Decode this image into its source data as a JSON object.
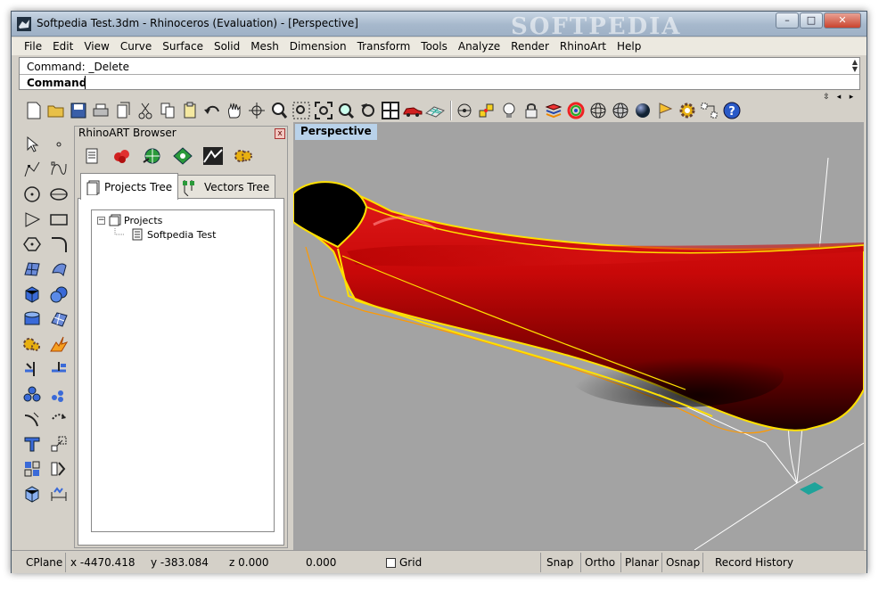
{
  "window": {
    "title": "Softpedia Test.3dm - Rhinoceros (Evaluation) - [Perspective]",
    "watermark": "SOFTPEDIA",
    "controls": {
      "minimize": "–",
      "maximize": "□",
      "close": "✕"
    }
  },
  "menu": [
    "File",
    "Edit",
    "View",
    "Curve",
    "Surface",
    "Solid",
    "Mesh",
    "Dimension",
    "Transform",
    "Tools",
    "Analyze",
    "Render",
    "RhinoArt",
    "Help"
  ],
  "command": {
    "history": "Command: _Delete",
    "prompt": "Command:",
    "value": ""
  },
  "toolbar": [
    "new-file-icon",
    "open-folder-icon",
    "save-icon",
    "print-icon",
    "import-icon",
    "cut-icon",
    "copy-icon",
    "paste-icon",
    "undo-icon",
    "pan-hand-icon",
    "rotate-view-icon",
    "zoom-icon",
    "zoom-window-icon",
    "zoom-extents-icon",
    "zoom-selected-icon",
    "undo-view-icon",
    "four-viewports-icon",
    "car-icon",
    "grid-plane-icon",
    "cplane-icon",
    "osnap-icon",
    "light-bulb-icon",
    "lock-icon",
    "layers-icon",
    "color-wheel-icon",
    "wireframe-sphere-icon",
    "shaded-sphere-icon",
    "rendered-sphere-icon",
    "flag-icon",
    "gear-icon",
    "options-icon",
    "help-icon"
  ],
  "left_toolbar": [
    "select-arrow-icon",
    "point-icon",
    "polyline-icon",
    "curve-icon",
    "circle-icon",
    "ellipse-icon",
    "arc-icon",
    "rectangle-icon",
    "polygon-icon",
    "fillet-icon",
    "surface-icon",
    "loft-icon",
    "box-icon",
    "sphere-icon",
    "cylinder-icon",
    "mesh-icon",
    "boolean-icon",
    "explode-icon",
    "trim-icon",
    "split-icon",
    "group-icon",
    "array-icon",
    "offset-icon",
    "move-icon",
    "text-icon",
    "scale-icon",
    "block-icon",
    "mirror-icon",
    "box-edit-icon",
    "dimension-icon"
  ],
  "browser": {
    "title": "RhinoART Browser",
    "close": "x",
    "tools": [
      "document-icon",
      "paint-blob-icon",
      "globe-icon",
      "material-icon",
      "image-icon",
      "gear-icon"
    ],
    "tabs": [
      {
        "label": "Projects Tree",
        "active": true
      },
      {
        "label": "Vectors Tree",
        "active": false
      }
    ],
    "tree": {
      "root": "Projects",
      "expander": "−",
      "children": [
        "Softpedia Test"
      ]
    }
  },
  "viewport": {
    "label": "Perspective",
    "colors": {
      "background": "#a3a3a3",
      "surface": "#c80808",
      "edge": "#ffe000",
      "curve": "#ff9a00",
      "axis": "#ffffff"
    }
  },
  "status": {
    "cplane": "CPlane",
    "x": "x -4470.418",
    "y": "y -383.084",
    "z": "z 0.000",
    "w": "0.000",
    "grid": "Grid",
    "snap": "Snap",
    "ortho": "Ortho",
    "planar": "Planar",
    "osnap": "Osnap",
    "record": "Record History"
  }
}
